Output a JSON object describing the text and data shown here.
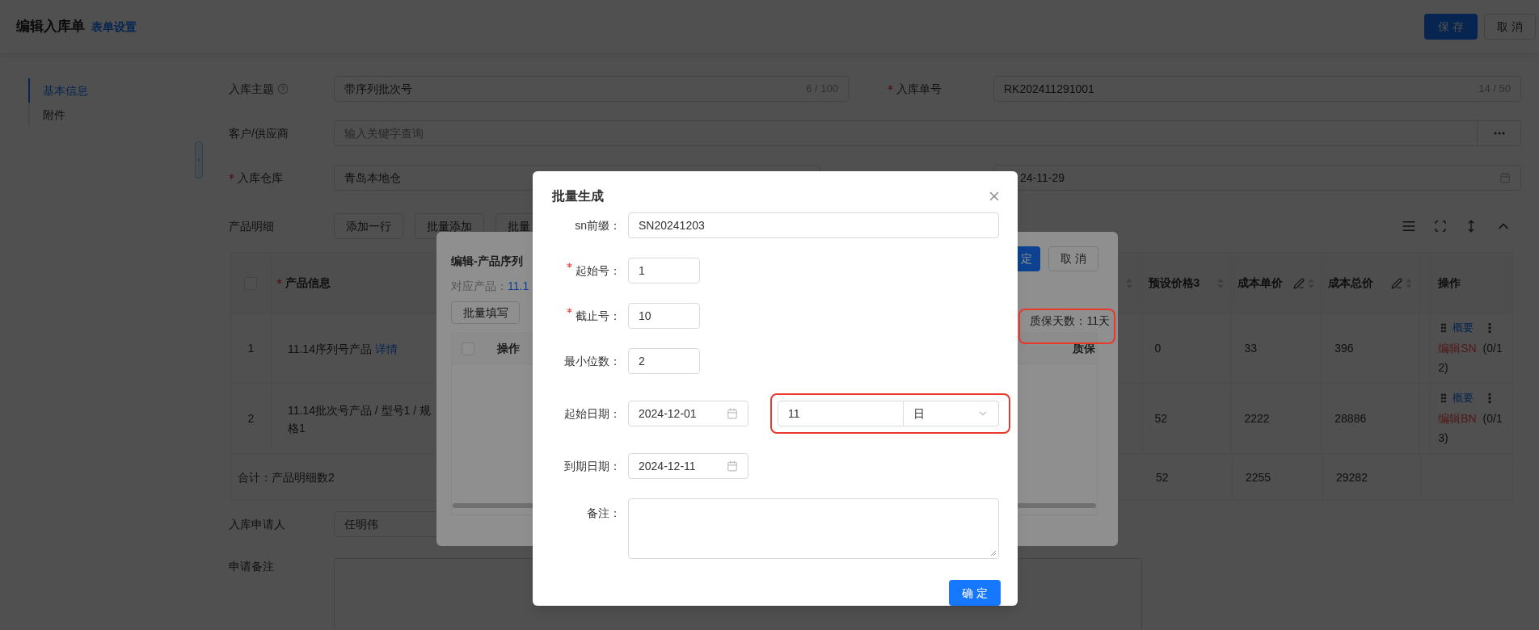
{
  "page": {
    "title": "编辑入库单",
    "settings_link": "表单设置",
    "buttons": [
      {
        "label": "保 存",
        "kind": "primary"
      },
      {
        "label": "取 消",
        "kind": "default"
      }
    ]
  },
  "nav": [
    {
      "label": "基本信息",
      "selected": true
    },
    {
      "label": "附件",
      "selected": false
    }
  ],
  "form": {
    "subject": {
      "label": "入库主题",
      "required": false,
      "value": "带序列批次号",
      "count": "6 / 100"
    },
    "order_no": {
      "label": "入库单号",
      "required": true,
      "value": "RK202411291001",
      "count": "14 / 50"
    },
    "supplier": {
      "label": "客户/供应商",
      "required": false,
      "placeholder": "输入关键字查询"
    },
    "warehouse": {
      "label": "入库仓库",
      "required": true,
      "value": "青岛本地仓"
    },
    "date": {
      "value": "24-11-29"
    }
  },
  "detail": {
    "label": "产品明细",
    "buttons": [
      "添加一行",
      "批量添加",
      "批量"
    ]
  },
  "table": {
    "header_checkbox": {
      "checked": false
    },
    "product_header": "产品信息",
    "product_required": true,
    "columns": [
      {
        "label": "预设价格3",
        "editable": false
      },
      {
        "label": "成本单价",
        "editable": true
      },
      {
        "label": "成本总价",
        "editable": true
      }
    ],
    "action_header": "操作",
    "rows": [
      {
        "index": "1",
        "product": "11.14序列号产品",
        "detail_link": "详情",
        "values": [
          "0",
          "33",
          "396"
        ],
        "summary_link": "概要",
        "edit_link": "编辑SN",
        "count": "(0/12)"
      },
      {
        "index": "2",
        "product": "11.14批次号产品 / 型号1 / 规格1",
        "values": [
          "52",
          "2222",
          "28886"
        ],
        "summary_link": "概要",
        "edit_link": "编辑BN",
        "count": "(0/13)"
      }
    ],
    "total": {
      "label": "合计：产品明细数2",
      "values": [
        "52",
        "2255",
        "29282"
      ]
    }
  },
  "applicant": {
    "label": "入库申请人",
    "value": "任明伟"
  },
  "remark": {
    "label": "申请备注"
  },
  "serial_dialog": {
    "title": "编辑-产品序列",
    "product_label": "对应产品：",
    "product_value": "11.1",
    "fill_button": "批量填写",
    "confirm": "定",
    "cancel": "取 消",
    "warranty": "质保天数：11天",
    "header_checkbox": {
      "checked": false
    },
    "columns": [
      "操作",
      "质保"
    ]
  },
  "batch_dialog": {
    "title": "批量生成",
    "fields": [
      {
        "kind": "text",
        "label": "sn前缀：",
        "required": false,
        "value": "SN20241203"
      },
      {
        "kind": "short",
        "label": "起始号：",
        "required": true,
        "value": "1"
      },
      {
        "kind": "short",
        "label": "截止号：",
        "required": true,
        "value": "10"
      },
      {
        "kind": "short",
        "label": "最小位数：",
        "required": false,
        "value": "2"
      },
      {
        "kind": "date",
        "label": "起始日期：",
        "required": false,
        "value": "2024-12-01",
        "duration": {
          "value": "11",
          "unit": "日"
        }
      },
      {
        "kind": "date",
        "label": "到期日期：",
        "required": false,
        "value": "2024-12-11"
      },
      {
        "kind": "textarea",
        "label": "备注：",
        "required": false
      }
    ],
    "confirm": "确 定"
  }
}
